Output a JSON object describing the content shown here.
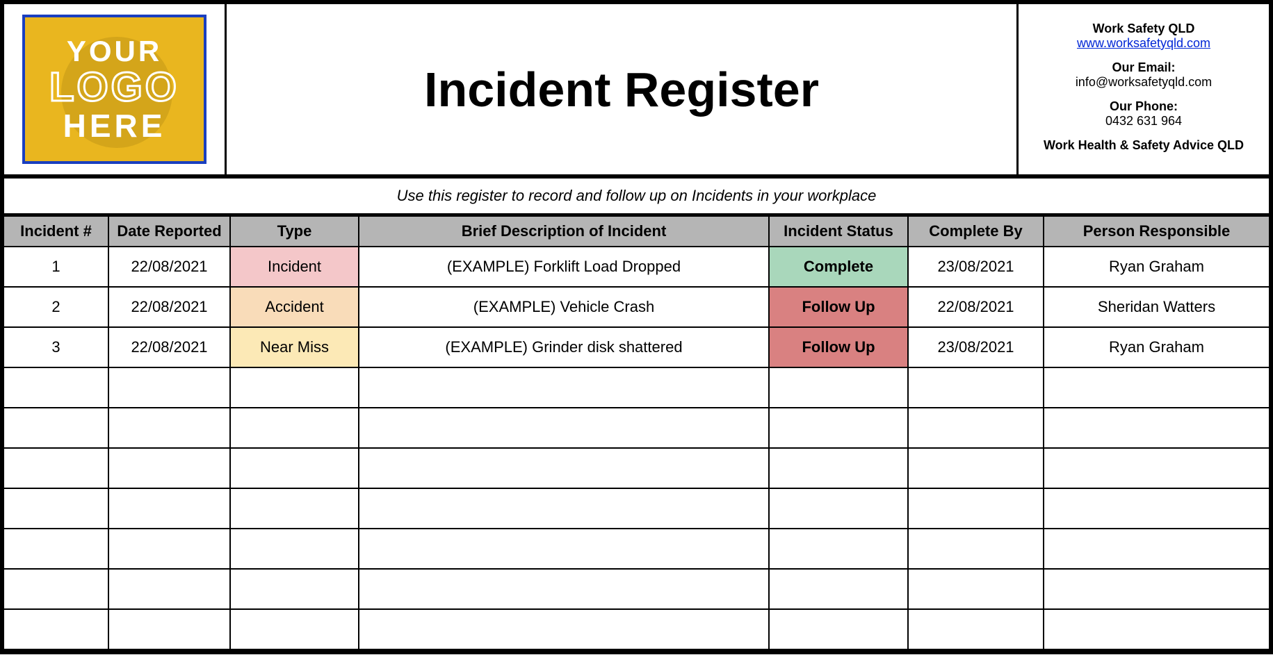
{
  "header": {
    "logo": {
      "line1": "YOUR",
      "line2": "LOGO",
      "line3": "HERE"
    },
    "title": "Incident Register",
    "contact": {
      "company": "Work Safety QLD",
      "website": "www.worksafetyqld.com",
      "email_label": "Our Email:",
      "email": "info@worksafetyqld.com",
      "phone_label": "Our Phone:",
      "phone": "0432 631 964",
      "tagline": "Work Health & Safety Advice QLD"
    }
  },
  "subtitle": "Use this register to record and follow up on Incidents in your workplace",
  "columns": {
    "num": "Incident #",
    "date": "Date Reported",
    "type": "Type",
    "desc": "Brief Description of Incident",
    "status": "Incident Status",
    "complete": "Complete By",
    "person": "Person Responsible"
  },
  "rows": [
    {
      "num": "1",
      "date": "22/08/2021",
      "type": "Incident",
      "type_class": "type-incident",
      "desc": "(EXAMPLE) Forklift Load Dropped",
      "status": "Complete",
      "status_class": "status-complete",
      "complete": "23/08/2021",
      "person": "Ryan Graham"
    },
    {
      "num": "2",
      "date": "22/08/2021",
      "type": "Accident",
      "type_class": "type-accident",
      "desc": "(EXAMPLE) Vehicle Crash",
      "status": "Follow Up",
      "status_class": "status-followup",
      "complete": "22/08/2021",
      "person": "Sheridan Watters"
    },
    {
      "num": "3",
      "date": "22/08/2021",
      "type": "Near Miss",
      "type_class": "type-nearmiss",
      "desc": "(EXAMPLE) Grinder disk shattered",
      "status": "Follow Up",
      "status_class": "status-followup",
      "complete": "23/08/2021",
      "person": "Ryan Graham"
    }
  ],
  "empty_row_count": 7
}
